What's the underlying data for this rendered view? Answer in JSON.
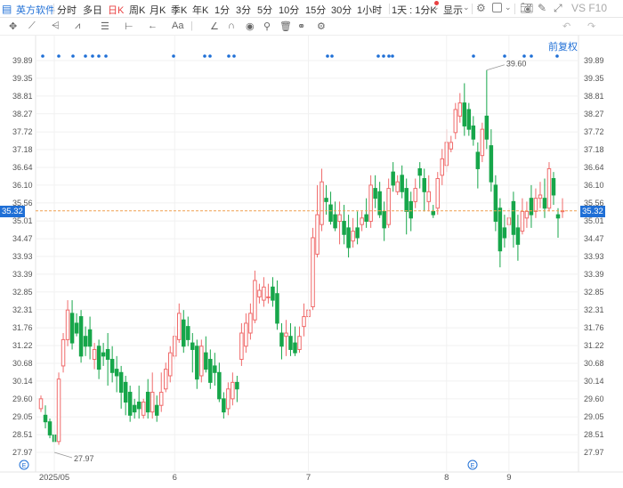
{
  "toolbar": {
    "symbol": "英方软件",
    "periods": [
      "分时",
      "多日",
      "日K",
      "周K",
      "月K",
      "季K",
      "年K",
      "1分",
      "3分",
      "5分",
      "10分",
      "15分",
      "30分",
      "1小时",
      "1天 : 1分K",
      "显示"
    ],
    "active_period": "日K",
    "right_label": "VS F10"
  },
  "restore_label": "前复权",
  "chart_data": {
    "type": "candlestick",
    "y_ticks": [
      "39.89",
      "39.35",
      "38.81",
      "38.27",
      "37.72",
      "37.18",
      "36.64",
      "36.10",
      "35.56",
      "35.01",
      "34.47",
      "33.93",
      "33.39",
      "32.85",
      "32.31",
      "31.76",
      "31.22",
      "30.68",
      "30.14",
      "29.60",
      "29.05",
      "28.51",
      "27.97"
    ],
    "ylim": [
      27.97,
      39.89
    ],
    "x_labels": [
      "2025/05",
      "6",
      "7",
      "8",
      "9"
    ],
    "current_price": "35.32",
    "max_label": "39.60",
    "min_label": "27.97",
    "event_markers": [
      "E",
      "E"
    ],
    "up_color": "#f06b6b",
    "down_color": "#17a64a",
    "candles": [
      [
        29.3,
        29.7,
        29.6,
        29.2
      ],
      [
        29.1,
        29.4,
        28.9,
        28.7
      ],
      [
        28.9,
        29.0,
        28.5,
        28.4
      ],
      [
        28.5,
        28.8,
        28.3,
        28.0
      ],
      [
        28.3,
        30.4,
        30.2,
        28.2
      ],
      [
        30.6,
        31.6,
        31.4,
        30.4
      ],
      [
        31.4,
        32.6,
        32.3,
        31.2
      ],
      [
        32.2,
        32.6,
        31.3,
        31.1
      ],
      [
        31.9,
        32.2,
        31.6,
        31.5
      ],
      [
        32.1,
        32.3,
        30.9,
        30.7
      ],
      [
        31.5,
        31.8,
        31.2,
        30.9
      ],
      [
        31.7,
        32.1,
        31.2,
        30.8
      ],
      [
        30.8,
        31.3,
        31.1,
        30.5
      ],
      [
        31.2,
        31.4,
        30.5,
        30.2
      ],
      [
        31.0,
        31.3,
        30.9,
        30.6
      ],
      [
        31.1,
        31.6,
        30.8,
        30.0
      ],
      [
        30.8,
        31.2,
        30.4,
        30.1
      ],
      [
        30.5,
        30.9,
        30.3,
        29.8
      ],
      [
        30.4,
        30.6,
        29.8,
        29.3
      ],
      [
        30.1,
        30.3,
        29.5,
        29.1
      ],
      [
        29.8,
        30.0,
        29.1,
        28.9
      ],
      [
        29.4,
        29.6,
        29.2,
        29.0
      ],
      [
        29.5,
        30.0,
        29.3,
        29.0
      ],
      [
        29.1,
        29.6,
        29.5,
        29.0
      ],
      [
        29.8,
        30.2,
        29.2,
        29.0
      ],
      [
        29.2,
        30.4,
        29.8,
        29.0
      ],
      [
        29.4,
        29.7,
        29.1,
        28.9
      ],
      [
        29.4,
        30.4,
        29.8,
        29.2
      ],
      [
        29.9,
        30.7,
        30.5,
        29.8
      ],
      [
        30.3,
        31.2,
        31.0,
        30.1
      ],
      [
        30.9,
        31.8,
        31.5,
        30.8
      ],
      [
        31.4,
        32.5,
        32.2,
        31.3
      ],
      [
        32.0,
        32.3,
        31.2,
        31.0
      ],
      [
        31.8,
        32.1,
        31.4,
        31.2
      ],
      [
        31.3,
        31.6,
        31.1,
        30.4
      ],
      [
        31.2,
        31.4,
        30.2,
        29.9
      ],
      [
        30.3,
        31.4,
        31.2,
        30.1
      ],
      [
        31.0,
        31.5,
        30.5,
        30.4
      ],
      [
        30.8,
        31.1,
        30.1,
        29.9
      ],
      [
        30.6,
        31.0,
        30.4,
        30.0
      ],
      [
        30.4,
        30.7,
        29.6,
        29.5
      ],
      [
        29.6,
        29.8,
        29.2,
        29.0
      ],
      [
        29.3,
        30.1,
        29.9,
        29.1
      ],
      [
        29.6,
        30.4,
        30.1,
        29.4
      ],
      [
        30.1,
        30.3,
        29.9,
        29.5
      ],
      [
        30.8,
        31.9,
        31.6,
        30.6
      ],
      [
        31.2,
        32.2,
        31.9,
        31.0
      ],
      [
        31.6,
        32.5,
        32.2,
        31.4
      ],
      [
        32.0,
        33.5,
        33.2,
        31.9
      ],
      [
        32.7,
        33.1,
        32.9,
        32.5
      ],
      [
        32.6,
        33.3,
        33.0,
        32.4
      ],
      [
        32.7,
        33.1,
        32.7,
        32.5
      ],
      [
        33.0,
        33.3,
        32.6,
        32.4
      ],
      [
        32.8,
        33.2,
        31.9,
        31.7
      ],
      [
        31.6,
        31.9,
        31.2,
        30.8
      ],
      [
        31.5,
        32.0,
        31.6,
        30.9
      ],
      [
        31.5,
        31.9,
        31.1,
        30.9
      ],
      [
        31.3,
        31.8,
        31.0,
        30.9
      ],
      [
        31.1,
        31.8,
        31.5,
        31.0
      ],
      [
        31.8,
        32.5,
        32.1,
        31.5
      ],
      [
        32.1,
        33.5,
        32.3,
        31.9
      ],
      [
        32.4,
        34.8,
        34.5,
        32.3
      ],
      [
        34.0,
        36.1,
        35.2,
        33.9
      ],
      [
        34.9,
        36.6,
        36.2,
        34.7
      ],
      [
        35.7,
        36.1,
        35.6,
        35.2
      ],
      [
        35.5,
        35.9,
        35.0,
        34.9
      ],
      [
        35.2,
        35.6,
        34.8,
        34.7
      ],
      [
        35.0,
        35.6,
        35.2,
        34.3
      ],
      [
        35.0,
        35.5,
        34.6,
        34.3
      ],
      [
        34.8,
        35.2,
        34.2,
        33.9
      ],
      [
        34.4,
        35.1,
        34.7,
        34.2
      ],
      [
        34.8,
        35.3,
        34.5,
        34.3
      ],
      [
        34.9,
        35.3,
        35.1,
        34.7
      ],
      [
        35.2,
        35.7,
        35.0,
        34.8
      ],
      [
        35.0,
        36.4,
        36.1,
        34.8
      ],
      [
        36.0,
        36.4,
        35.7,
        35.4
      ],
      [
        35.9,
        36.2,
        35.2,
        35.1
      ],
      [
        35.3,
        35.6,
        34.8,
        34.4
      ],
      [
        34.9,
        36.3,
        36.0,
        34.8
      ],
      [
        36.5,
        36.8,
        36.1,
        35.9
      ],
      [
        35.9,
        36.4,
        36.2,
        35.8
      ],
      [
        36.4,
        36.7,
        35.9,
        35.7
      ],
      [
        36.0,
        36.3,
        35.3,
        34.6
      ],
      [
        35.6,
        35.9,
        35.1,
        34.7
      ],
      [
        35.6,
        36.3,
        36.0,
        35.4
      ],
      [
        36.6,
        36.8,
        36.4,
        36.0
      ],
      [
        36.3,
        36.6,
        35.9,
        35.3
      ],
      [
        35.6,
        36.4,
        35.9,
        35.3
      ],
      [
        35.3,
        35.5,
        35.2,
        35.1
      ],
      [
        35.4,
        36.5,
        36.3,
        35.2
      ],
      [
        36.4,
        37.2,
        36.9,
        36.1
      ],
      [
        36.7,
        37.8,
        37.4,
        36.5
      ],
      [
        37.2,
        37.6,
        37.4,
        37.1
      ],
      [
        37.7,
        38.6,
        38.4,
        37.5
      ],
      [
        38.2,
        38.9,
        38.6,
        38.0
      ],
      [
        38.6,
        39.2,
        37.9,
        37.6
      ],
      [
        38.4,
        38.6,
        37.8,
        37.6
      ],
      [
        37.9,
        38.2,
        37.5,
        37.3
      ],
      [
        37.1,
        37.4,
        36.6,
        36.0
      ],
      [
        37.0,
        38.0,
        37.8,
        36.8
      ],
      [
        38.2,
        39.6,
        37.5,
        37.2
      ],
      [
        37.3,
        37.8,
        36.2,
        35.9
      ],
      [
        36.1,
        36.4,
        35.0,
        34.7
      ],
      [
        35.4,
        35.7,
        34.1,
        33.6
      ],
      [
        34.8,
        35.2,
        34.5,
        34.2
      ],
      [
        34.9,
        35.4,
        35.1,
        34.5
      ],
      [
        35.6,
        35.9,
        34.6,
        34.2
      ],
      [
        34.8,
        35.2,
        34.3,
        33.8
      ],
      [
        34.7,
        35.7,
        35.3,
        34.6
      ],
      [
        35.1,
        35.6,
        35.3,
        34.8
      ],
      [
        35.7,
        36.1,
        35.2,
        34.8
      ],
      [
        35.3,
        36.0,
        35.7,
        35.1
      ],
      [
        35.7,
        36.2,
        35.8,
        35.4
      ],
      [
        35.7,
        36.3,
        35.4,
        35.1
      ],
      [
        35.4,
        36.8,
        36.6,
        35.3
      ],
      [
        36.3,
        36.5,
        35.8,
        35.5
      ],
      [
        35.2,
        35.4,
        35.1,
        34.5
      ],
      [
        35.3,
        35.7,
        35.32,
        35.1
      ]
    ]
  }
}
